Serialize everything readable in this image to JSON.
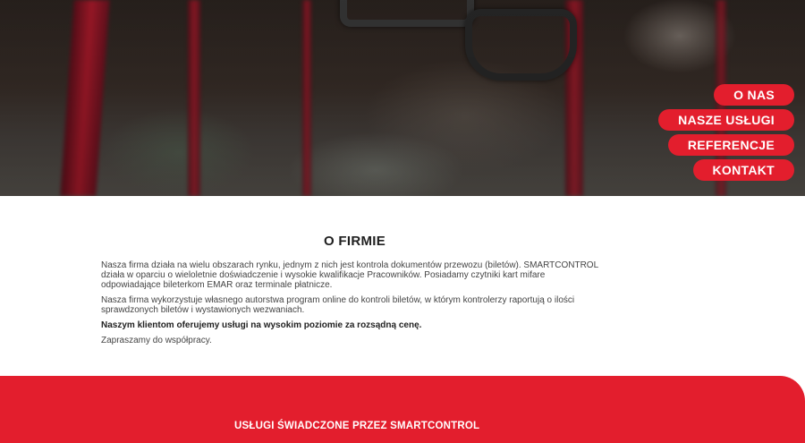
{
  "nav": {
    "items": [
      {
        "label": "O NAS"
      },
      {
        "label": "NASZE USŁUGI"
      },
      {
        "label": "REFERENCJE"
      },
      {
        "label": "KONTAKT"
      }
    ]
  },
  "about": {
    "title": "O FIRMIE",
    "paragraphs": [
      "Nasza firma działa na wielu obszarach rynku, jednym z nich jest kontrola dokumentów przewozu (biletów). SMARTCONTROL działa w oparciu o wieloletnie doświadczenie i wysokie kwalifikacje Pracowników. Posiadamy czytniki kart mifare odpowiadające bileterkom EMAR oraz terminale płatnicze.",
      "Nasza firma wykorzystuje własnego autorstwa program online do kontroli biletów, w którym kontrolerzy raportują o ilości sprawdzonych biletów i wystawionych wezwaniach.",
      "Naszym klientom oferujemy usługi na wysokim poziomie za rozsądną cenę.",
      "Zapraszamy do współpracy."
    ]
  },
  "services": {
    "title": "USŁUGI ŚWIADCZONE PRZEZ SMARTCONTROL"
  },
  "colors": {
    "accent": "#e31e2d"
  }
}
